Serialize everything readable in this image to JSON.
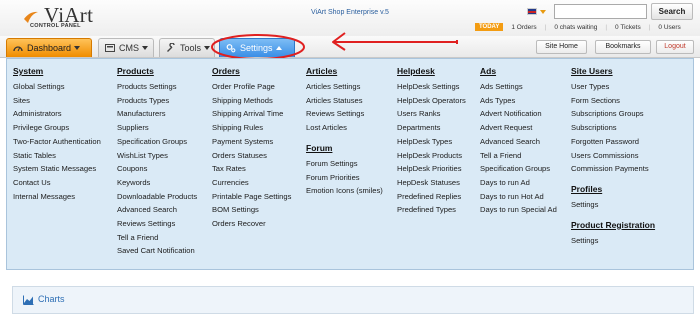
{
  "header": {
    "logo_text": "ViArt",
    "logo_subtitle": "CONTROL PANEL",
    "edition": "ViArt Shop Enterprise v.5",
    "search_placeholder": "",
    "search_button": "Search",
    "today_badge": "TODAY",
    "stats": [
      "1 Orders",
      "0 chats waiting",
      "0 Tickets",
      "0 Users"
    ],
    "colors": {
      "today_badge": "#f39c12",
      "edition_text": "#2b5f9e"
    }
  },
  "nav": {
    "tabs": [
      {
        "label": "Dashboard",
        "icon": "dashboard-icon"
      },
      {
        "label": "CMS",
        "icon": "cms-icon"
      },
      {
        "label": "Tools",
        "icon": "wrench-icon"
      },
      {
        "label": "Settings",
        "icon": "gears-icon",
        "active": true
      }
    ],
    "buttons": [
      "Site Home",
      "Bookmarks",
      "Logout"
    ],
    "colors": {
      "dashboard": "#f08c00",
      "settings": "#3a8ee6",
      "annotation": "#e02020"
    }
  },
  "menu": {
    "columns": [
      {
        "title": "System",
        "items": [
          "Global Settings",
          "Sites",
          "Administrators",
          "Privilege Groups",
          "Two-Factor Authentication",
          "Static Tables",
          "System Static Messages",
          "Contact Us",
          "Internal Messages"
        ]
      },
      {
        "title": "Products",
        "items": [
          "Products Settings",
          "Products Types",
          "Manufacturers",
          "Suppliers",
          "Specification Groups",
          "WishList Types",
          "Coupons",
          "Keywords",
          "Downloadable Products",
          "Advanced Search",
          "Reviews Settings",
          "Tell a Friend",
          "Saved Cart Notification"
        ]
      },
      {
        "title": "Orders",
        "items": [
          "Order Profile Page",
          "Shipping Methods",
          "Shipping Arrival Time",
          "Shipping Rules",
          "Payment Systems",
          "Orders Statuses",
          "Tax Rates",
          "Currencies",
          "Printable Page Settings",
          "BOM Settings",
          "Orders Recover"
        ]
      },
      {
        "title": "Articles",
        "items": [
          "Articles Settings",
          "Articles Statuses",
          "Reviews Settings",
          "Lost Articles"
        ],
        "sub_title": "Forum",
        "sub_items": [
          "Forum Settings",
          "Forum Priorities",
          "Emotion Icons (smiles)"
        ]
      },
      {
        "title": "Helpdesk",
        "items": [
          "HelpDesk Settings",
          "HelpDesk Operators",
          "Users Ranks",
          "Departments",
          "HelpDesk Types",
          "HelpDesk Products",
          "HelpDesk Priorities",
          "HepDesk Statuses",
          "Predefined Replies",
          "Predefined Types"
        ]
      },
      {
        "title": "Ads",
        "items": [
          "Ads Settings",
          "Ads Types",
          "Advert Notification",
          "Advert Request",
          "Advanced Search",
          "Tell a Friend",
          "Specification Groups",
          "Days to run Ad",
          "Days to run Hot Ad",
          "Days to run Special Ad"
        ]
      },
      {
        "title": "Site Users",
        "items": [
          "User Types",
          "Form Sections",
          "Subscriptions Groups",
          "Subscriptions",
          "Forgotten Password",
          "Users Commissions",
          "Commission Payments"
        ],
        "sub_title": "Profiles",
        "sub_items": [
          "Settings"
        ],
        "sub2_title": "Product Registration",
        "sub2_items": [
          "Settings"
        ]
      }
    ]
  },
  "charts": {
    "title": "Charts"
  }
}
